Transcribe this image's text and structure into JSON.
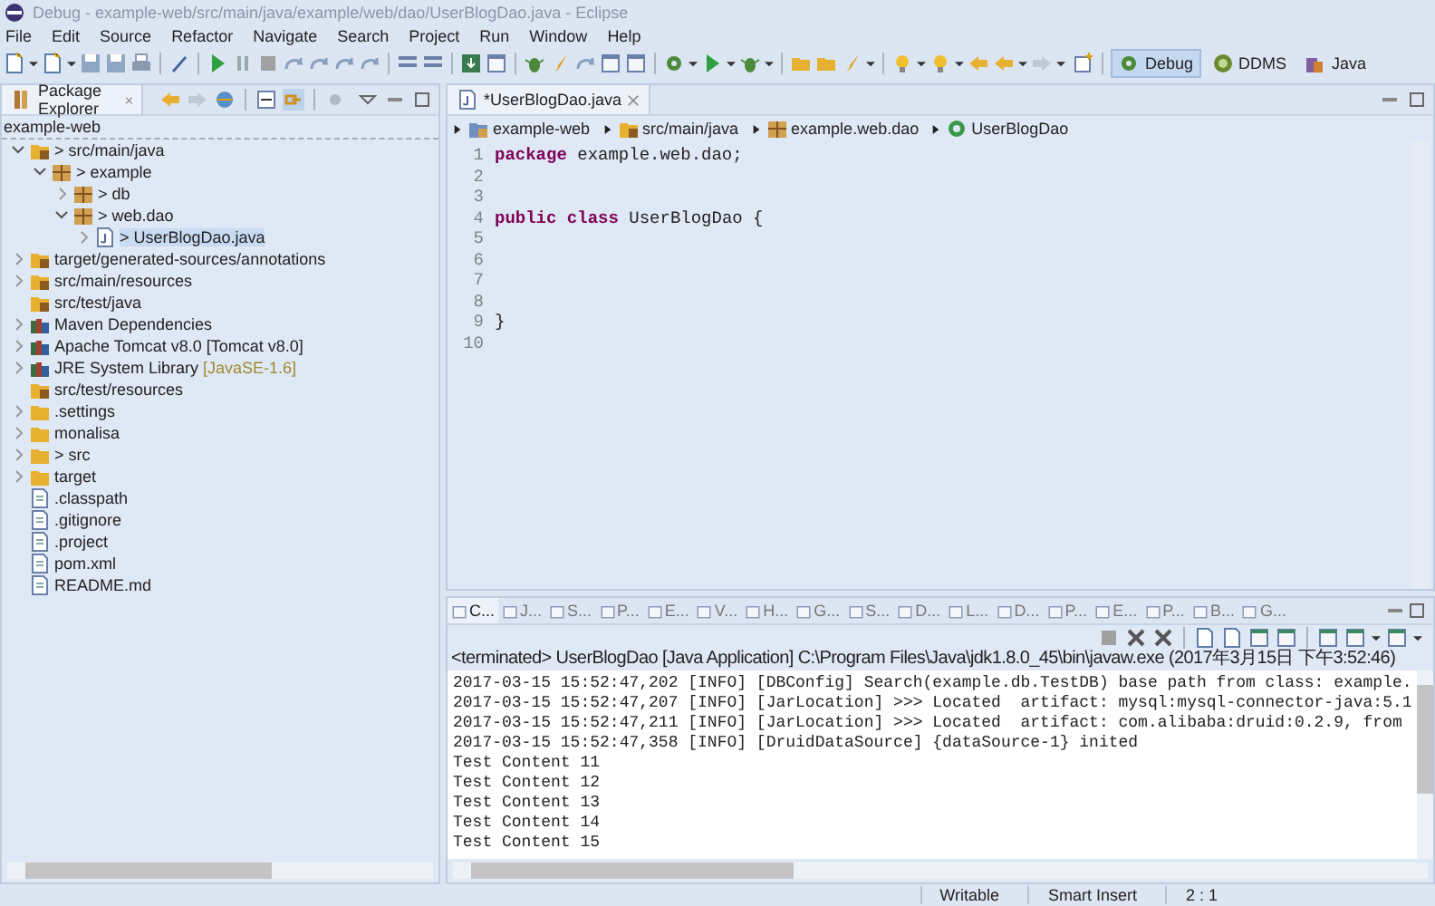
{
  "window": {
    "title": "Debug - example-web/src/main/java/example/web/dao/UserBlogDao.java - Eclipse"
  },
  "menu": [
    "File",
    "Edit",
    "Source",
    "Refactor",
    "Navigate",
    "Search",
    "Project",
    "Run",
    "Window",
    "Help"
  ],
  "perspectives": [
    {
      "label": "Debug",
      "kind": "debug",
      "selected": true
    },
    {
      "label": "DDMS",
      "kind": "ddms",
      "selected": false
    },
    {
      "label": "Java",
      "kind": "java",
      "selected": false
    }
  ],
  "package_explorer": {
    "title": "Package Explorer",
    "project_label": "example-web",
    "tree": [
      {
        "label": "> src/main/java",
        "kind": "source-folder",
        "expanded": true,
        "selected": false,
        "children": [
          {
            "label": "> example",
            "kind": "package",
            "expanded": true,
            "selected": false,
            "children": [
              {
                "label": "> db",
                "kind": "package",
                "expanded": false,
                "selected": false
              },
              {
                "label": "> web.dao",
                "kind": "package",
                "expanded": true,
                "selected": false,
                "children": [
                  {
                    "label": "> UserBlogDao.java",
                    "kind": "java-file",
                    "expanded": false,
                    "selected": true
                  }
                ]
              }
            ]
          }
        ]
      },
      {
        "label": "target/generated-sources/annotations",
        "kind": "source-folder",
        "expanded": false,
        "selected": false
      },
      {
        "label": "src/main/resources",
        "kind": "source-folder",
        "expanded": false,
        "selected": false
      },
      {
        "label": "src/test/java",
        "kind": "source-folder",
        "selected": false
      },
      {
        "label": "Maven Dependencies",
        "kind": "library",
        "expanded": false,
        "selected": false
      },
      {
        "label": "Apache Tomcat v8.0 [Tomcat v8.0]",
        "kind": "library",
        "expanded": false,
        "selected": false
      },
      {
        "label": "JRE System Library",
        "decoration": "[JavaSE-1.6]",
        "kind": "library",
        "expanded": false,
        "selected": false
      },
      {
        "label": "src/test/resources",
        "kind": "source-folder",
        "selected": false
      },
      {
        "label": ".settings",
        "kind": "folder",
        "expanded": false,
        "selected": false
      },
      {
        "label": "monalisa",
        "kind": "folder",
        "expanded": false,
        "selected": false
      },
      {
        "label": "> src",
        "kind": "folder",
        "expanded": false,
        "selected": false
      },
      {
        "label": "target",
        "kind": "folder",
        "expanded": false,
        "selected": false
      },
      {
        "label": ".classpath",
        "kind": "file",
        "selected": false
      },
      {
        "label": ".gitignore",
        "kind": "file",
        "selected": false
      },
      {
        "label": ".project",
        "kind": "file",
        "selected": false
      },
      {
        "label": "pom.xml",
        "kind": "file",
        "selected": false
      },
      {
        "label": "README.md",
        "kind": "file",
        "selected": false
      }
    ]
  },
  "editor": {
    "tab": "*UserBlogDao.java",
    "breadcrumb": [
      {
        "label": "example-web",
        "kind": "project"
      },
      {
        "label": "src/main/java",
        "kind": "source-folder"
      },
      {
        "label": "example.web.dao",
        "kind": "package"
      },
      {
        "label": "UserBlogDao",
        "kind": "class"
      }
    ],
    "lines": [
      {
        "number": "1",
        "code": "**package** example.web.dao;"
      },
      {
        "number": "2"
      },
      {
        "number": "3"
      },
      {
        "number": "4",
        "code": "**public** **class** UserBlogDao {"
      },
      {
        "number": "5"
      },
      {
        "number": "6"
      },
      {
        "number": "7"
      },
      {
        "number": "8"
      },
      {
        "number": "9",
        "code": "}"
      },
      {
        "number": "10"
      }
    ]
  },
  "console": {
    "tabs": [
      {
        "label": "C...",
        "selected": true
      },
      {
        "label": "J...",
        "selected": false
      },
      {
        "label": "S...",
        "selected": false
      },
      {
        "label": "P...",
        "selected": false
      },
      {
        "label": "E...",
        "selected": false
      },
      {
        "label": "V...",
        "selected": false
      },
      {
        "label": "H...",
        "selected": false
      },
      {
        "label": "G...",
        "selected": false
      },
      {
        "label": "S...",
        "selected": false
      },
      {
        "label": "D...",
        "selected": false
      },
      {
        "label": "L...",
        "selected": false
      },
      {
        "label": "D...",
        "selected": false
      },
      {
        "label": "P...",
        "selected": false
      },
      {
        "label": "E...",
        "selected": false
      },
      {
        "label": "P...",
        "selected": false
      },
      {
        "label": "B...",
        "selected": false
      },
      {
        "label": "G...",
        "selected": false
      }
    ],
    "header": "<terminated> UserBlogDao [Java Application] C:\\Program Files\\Java\\jdk1.8.0_45\\bin\\javaw.exe (2017年3月15日 下午3:52:46)",
    "lines": [
      "2017-03-15 15:52:47,202 [INFO] [DBConfig] Search(example.db.TestDB) base path from class: example.",
      "2017-03-15 15:52:47,207 [INFO] [JarLocation] >>> Located  artifact: mysql:mysql-connector-java:5.1",
      "2017-03-15 15:52:47,211 [INFO] [JarLocation] >>> Located  artifact: com.alibaba:druid:0.2.9, from",
      "2017-03-15 15:52:47,358 [INFO] [DruidDataSource] {dataSource-1} inited",
      "Test Content 11",
      "Test Content 12",
      "Test Content 13",
      "Test Content 14",
      "Test Content 15"
    ]
  },
  "status_bar": [
    "Writable",
    "Smart Insert",
    "2 : 1"
  ]
}
